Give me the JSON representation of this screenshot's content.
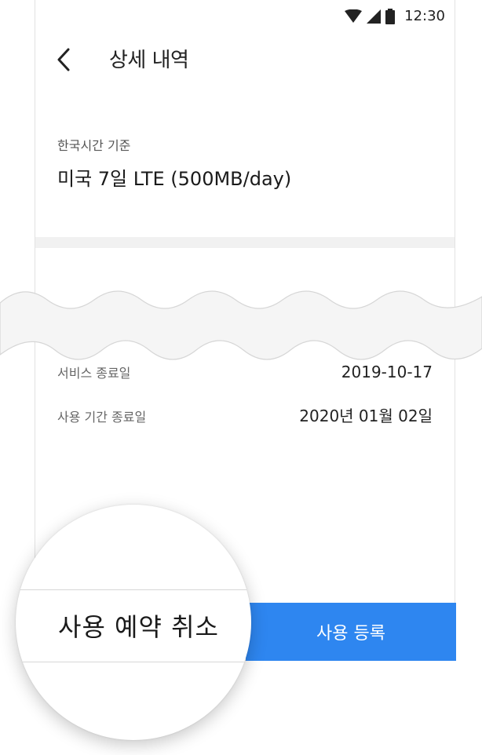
{
  "status_bar": {
    "time": "12:30",
    "icons": [
      "wifi-icon",
      "cell-signal-icon",
      "battery-icon"
    ]
  },
  "app_bar": {
    "back_icon": "chevron-left-icon",
    "title": "상세 내역"
  },
  "product": {
    "caption": "한국시간 기준",
    "name": "미국 7일 LTE (500MB/day)"
  },
  "details": [
    {
      "label": "서비스 종료일",
      "value": "2019-10-17"
    },
    {
      "label": "사용 기간 종료일",
      "value": "2020년 01월 02일"
    }
  ],
  "buttons": {
    "cancel_label": "사용 예약 취소",
    "register_label": "사용 등록"
  },
  "colors": {
    "accent": "#2e86f0",
    "band": "#f1f1f1"
  }
}
